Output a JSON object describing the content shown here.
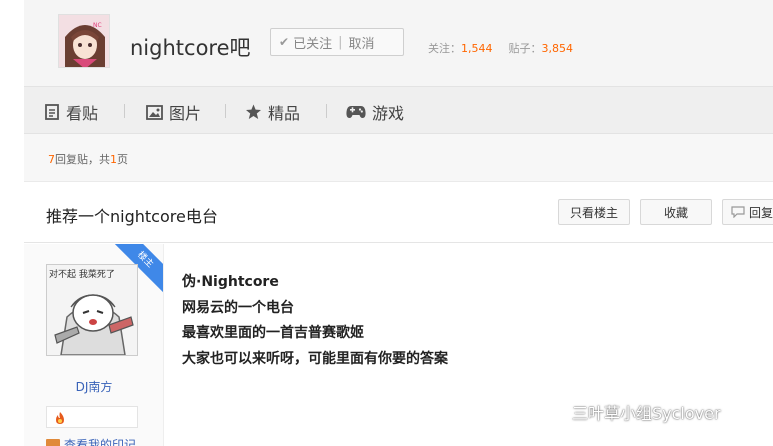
{
  "forum": {
    "name": "nightcore吧",
    "follow_status": "已关注",
    "unfollow_label": "取消",
    "stats": {
      "followers_label": "关注：",
      "followers": "1,544",
      "posts_label": "贴子：",
      "posts": "3,854"
    }
  },
  "nav": {
    "items": [
      {
        "label": "看贴",
        "icon": "document-icon"
      },
      {
        "label": "图片",
        "icon": "image-icon"
      },
      {
        "label": "精品",
        "icon": "star-icon"
      },
      {
        "label": "游戏",
        "icon": "gamepad-icon"
      }
    ]
  },
  "thread": {
    "reply_count": "7",
    "reply_text_a": "回复贴，共",
    "page_count": "1",
    "reply_text_b": "页",
    "title": "推荐一个nightcore电台",
    "actions": {
      "only_op": "只看楼主",
      "favorite": "收藏",
      "reply": "回复"
    }
  },
  "post": {
    "badge": "楼主",
    "author": "DJ南方",
    "avatar_caption": "对不起 我菜死了",
    "view_link": "查看我的印记",
    "lines": [
      "伪·Nightcore",
      "网易云的一个电台",
      "最喜欢里面的一首吉普赛歌姬",
      "大家也可以来听呀，可能里面有你要的答案"
    ]
  },
  "watermark": "三叶草小组Syclover",
  "colors": {
    "accent_orange": "#ff6600",
    "link_blue": "#3862b8",
    "badge_blue": "#3f88e8"
  }
}
